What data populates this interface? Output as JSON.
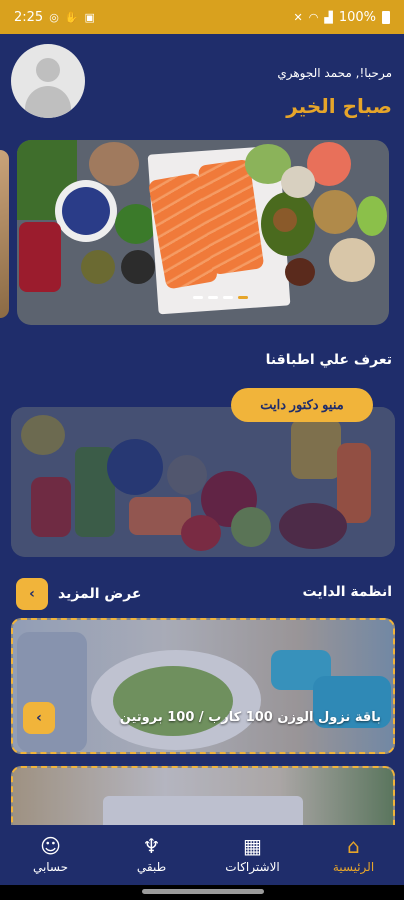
{
  "status_bar": {
    "time": "2:25",
    "battery": "100%"
  },
  "header": {
    "greeting": "مرحبا!, محمد الجوهري",
    "morning": "صباح الخير"
  },
  "carousel": {
    "slides": 4,
    "active_slide": 4
  },
  "menu_section": {
    "title": "تعرف علي اطباقنا",
    "button_label": "منيو دكتور دايت"
  },
  "diet_section": {
    "title": "انظمة الدايت",
    "more_label": "عرض المزيد",
    "arrow": "‹",
    "plans": [
      {
        "name": "باقة نزول الوزن 100 كارب / 100 بروتين"
      },
      {
        "name": ""
      }
    ]
  },
  "bottom_nav": {
    "items": [
      {
        "label": "الرئيسية",
        "icon": "home-icon",
        "active": true
      },
      {
        "label": "الاشتراكات",
        "icon": "store-icon",
        "active": false
      },
      {
        "label": "طبقي",
        "icon": "cutlery-icon",
        "active": false
      },
      {
        "label": "حسابي",
        "icon": "user-icon",
        "active": false
      }
    ]
  },
  "colors": {
    "background": "#1f2d6b",
    "accent": "#f1b43a",
    "title_accent": "#e6a52a"
  }
}
